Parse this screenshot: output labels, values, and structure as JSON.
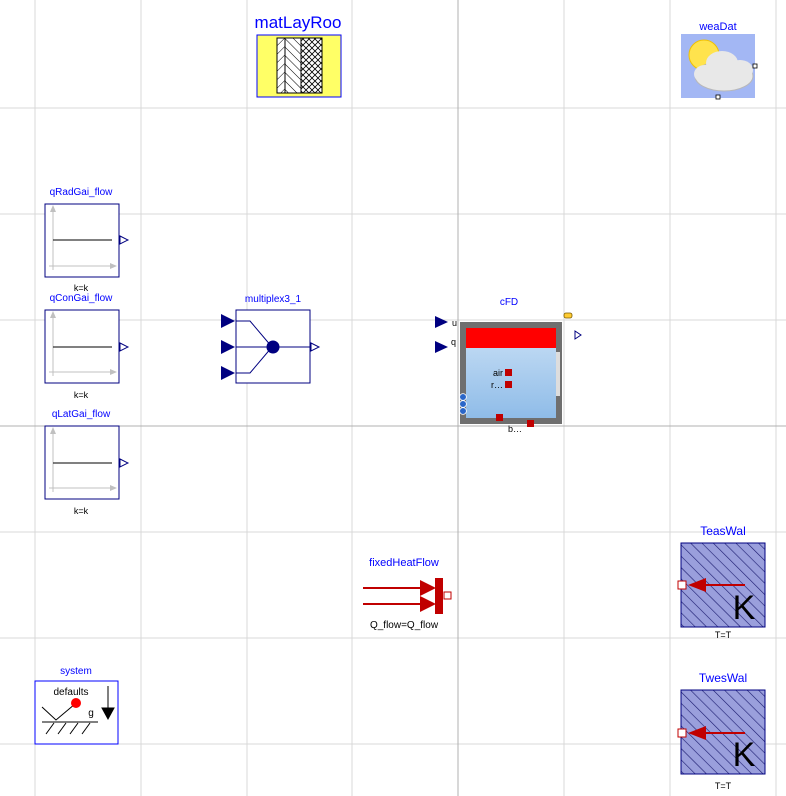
{
  "diagram": {
    "components": {
      "matLayRoo": {
        "name": "matLayRoo"
      },
      "weaDat": {
        "name": "weaDat"
      },
      "qRadGai_flow": {
        "name": "qRadGai_flow",
        "param": "k=k"
      },
      "qConGai_flow": {
        "name": "qConGai_flow",
        "param": "k=k"
      },
      "qLatGai_flow": {
        "name": "qLatGai_flow",
        "param": "k=k"
      },
      "multiplex3_1": {
        "name": "multiplex3_1"
      },
      "cFD": {
        "name": "cFD",
        "port_u": "u",
        "port_q": "q",
        "port_air": "air",
        "port_r": "r…",
        "port_b": "b…"
      },
      "fixedHeatFlow": {
        "name": "fixedHeatFlow",
        "param": "Q_flow=Q_flow"
      },
      "TeasWal": {
        "name": "TeasWal",
        "param": "T=T",
        "unit": "K"
      },
      "TwesWal": {
        "name": "TwesWal",
        "param": "T=T",
        "unit": "K"
      },
      "system": {
        "name": "system",
        "inner_label": "defaults",
        "gravity_label": "g"
      }
    },
    "colors": {
      "label_blue": "#0000ff",
      "grid": "#d8d8d8",
      "signal_blue": "#000080",
      "heat_red": "#c00000",
      "room_fill": "#a6cbed",
      "room_frame": "#6f6f6f",
      "hatch_fill": "#9a9fdc",
      "wall_yellow": "#ffff66",
      "weather_bg": "#a3b7f4"
    }
  }
}
